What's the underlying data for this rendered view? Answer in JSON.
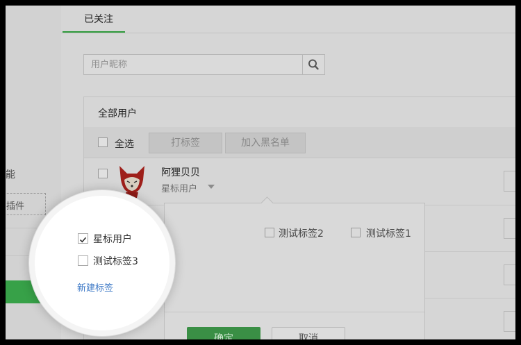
{
  "sidebar": {
    "partial_text": "能",
    "dashed_box_text": "插件"
  },
  "tabs": {
    "active_label": "已关注"
  },
  "search": {
    "placeholder": "用户昵称",
    "icon": "search-icon"
  },
  "user_list": {
    "header": "全部用户",
    "select_all_label": "全选",
    "buttons": {
      "tag_label": "打标签",
      "blacklist_label": "加入黑名单"
    },
    "users": [
      {
        "name": "阿狸贝贝",
        "tag": "星标用户"
      }
    ]
  },
  "tag_popover": {
    "options": [
      {
        "label": "星标用户",
        "checked": true
      },
      {
        "label": "测试标签2",
        "checked": false
      },
      {
        "label": "测试标签1",
        "checked": false
      },
      {
        "label": "测试标签3",
        "checked": false
      }
    ],
    "new_tag_link": "新建标签",
    "confirm_label": "确定",
    "cancel_label": "取消"
  },
  "colors": {
    "accent_green": "#44b954",
    "link_blue": "#3c78c6"
  }
}
